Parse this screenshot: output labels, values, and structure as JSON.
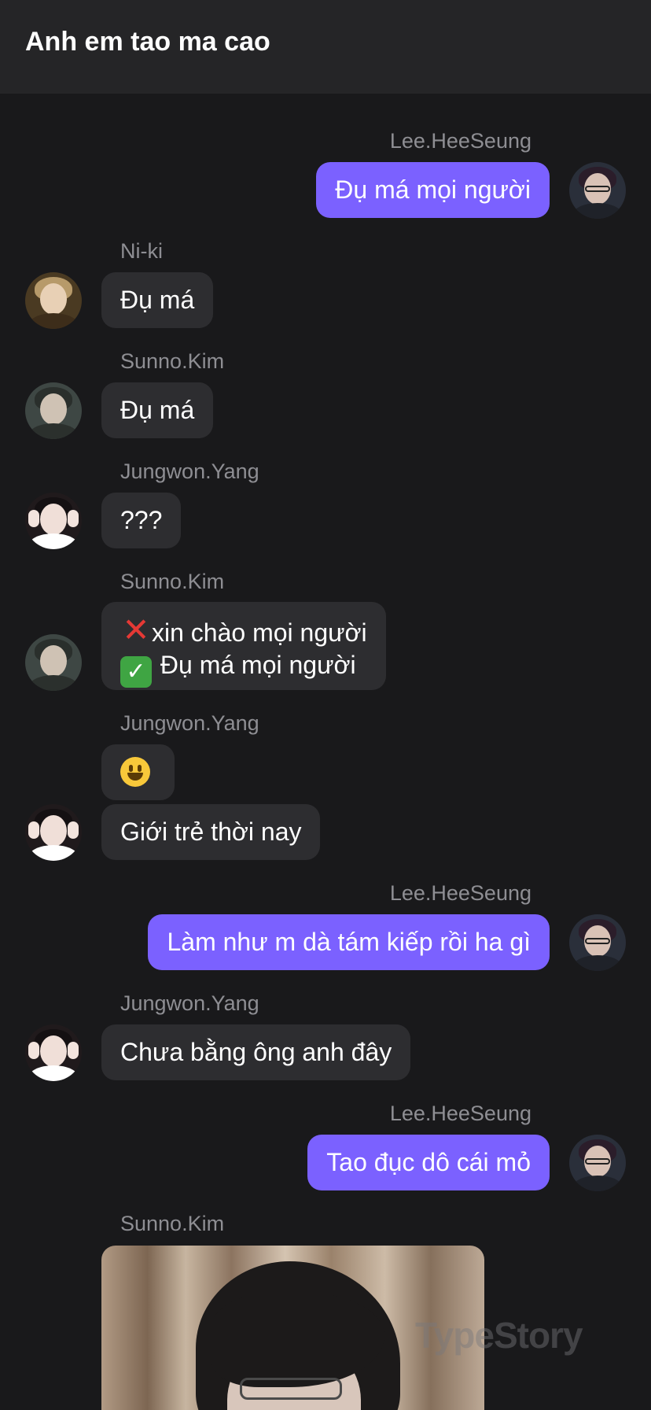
{
  "header": {
    "title": "Anh em tao ma cao"
  },
  "messages": [
    {
      "sender": "Lee.HeeSeung",
      "side": "out",
      "text": "Đụ má mọi người"
    },
    {
      "sender": "Ni-ki",
      "side": "in",
      "text": "Đụ má"
    },
    {
      "sender": "Sunno.Kim",
      "side": "in",
      "text": "Đụ má"
    },
    {
      "sender": "Jungwon.Yang",
      "side": "in",
      "text": "???"
    },
    {
      "sender": "Sunno.Kim",
      "side": "in",
      "line1": "xin chào mọi người",
      "line2": " Đụ má mọi người",
      "emoji1": "cross-mark-icon",
      "emoji2": "check-mark-icon"
    },
    {
      "sender": "Jungwon.Yang",
      "side": "in",
      "emoji": "smiley-icon",
      "text": "Giới trẻ thời nay"
    },
    {
      "sender": "Lee.HeeSeung",
      "side": "out",
      "text": "Làm như m dà tám kiếp rồi ha gì"
    },
    {
      "sender": "Jungwon.Yang",
      "side": "in",
      "text": "Chưa bằng ông anh đây"
    },
    {
      "sender": "Lee.HeeSeung",
      "side": "out",
      "text": "Tao đục dô cái mỏ"
    },
    {
      "sender": "Sunno.Kim",
      "side": "in",
      "attachment": "photo"
    }
  ],
  "watermark": "TypeStory",
  "colors": {
    "background": "#19191b",
    "header": "#252527",
    "outgoing_bubble": "#7b61ff",
    "incoming_bubble": "#2d2d30",
    "sender_name": "#8e8e93"
  }
}
